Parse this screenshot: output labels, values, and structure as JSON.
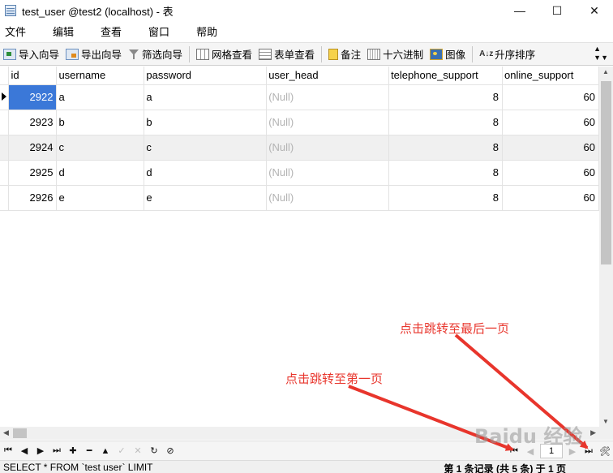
{
  "window": {
    "title": "test_user @test2 (localhost) - 表",
    "minimize_glyph": "—",
    "maximize_glyph": "☐",
    "close_glyph": "✕"
  },
  "menu": [
    "文件",
    "编辑",
    "查看",
    "窗口",
    "帮助"
  ],
  "toolbar": {
    "import": "导入向导",
    "export": "导出向导",
    "filter": "筛选向导",
    "grid_view": "网格查看",
    "form_view": "表单查看",
    "memo": "备注",
    "hex": "十六进制",
    "image": "图像",
    "sort_asc": "升序排序",
    "sort_icon_text": "A↓z"
  },
  "table": {
    "columns": [
      "id",
      "username",
      "password",
      "user_head",
      "telephone_support",
      "online_support"
    ],
    "rows": [
      {
        "id": "2922",
        "username": "a",
        "password": "a",
        "user_head": "(Null)",
        "telephone_support": "8",
        "online_support": "60"
      },
      {
        "id": "2923",
        "username": "b",
        "password": "b",
        "user_head": "(Null)",
        "telephone_support": "8",
        "online_support": "60"
      },
      {
        "id": "2924",
        "username": "c",
        "password": "c",
        "user_head": "(Null)",
        "telephone_support": "8",
        "online_support": "60"
      },
      {
        "id": "2925",
        "username": "d",
        "password": "d",
        "user_head": "(Null)",
        "telephone_support": "8",
        "online_support": "60"
      },
      {
        "id": "2926",
        "username": "e",
        "password": "e",
        "user_head": "(Null)",
        "telephone_support": "8",
        "online_support": "60"
      }
    ],
    "selected_row": 0
  },
  "navigator": {
    "first": "⏮",
    "prev": "◀",
    "next": "▶",
    "last": "⏭",
    "add": "✚",
    "delete": "━",
    "up": "▲",
    "apply": "✓",
    "cancel": "✕",
    "refresh": "↻",
    "stop": "⊘",
    "page_first": "⏮",
    "page_prev": "◀",
    "page_number": "1",
    "page_next": "▶",
    "page_last": "⏭",
    "settings_icon": "🛠"
  },
  "status": {
    "sql": "SELECT * FROM `test user` LIMIT",
    "records": "第 1 条记录 (共 5 条) 于 1 页"
  },
  "annotations": {
    "last_page_label": "点击跳转至最后一页",
    "first_page_label": "点击跳转至第一页",
    "color": "#e8352c"
  },
  "watermark": "Baidu 经验"
}
